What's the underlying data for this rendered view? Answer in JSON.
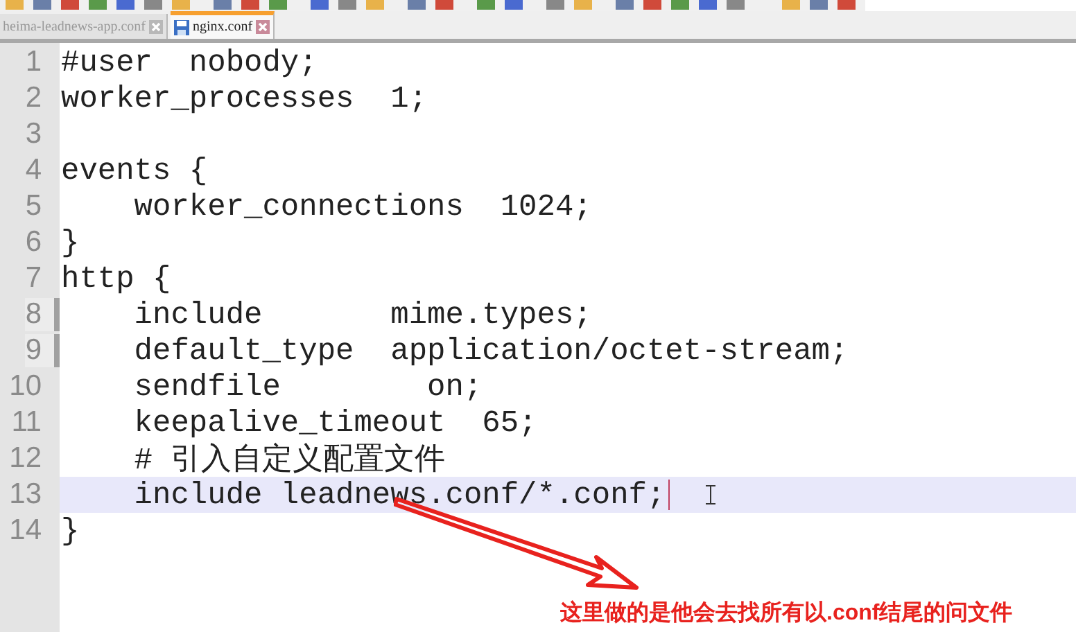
{
  "tabs": [
    {
      "label": "heima-leadnews-app.conf",
      "selected": false
    },
    {
      "label": "nginx.conf",
      "selected": true
    }
  ],
  "editor": {
    "lines": [
      {
        "number": "1",
        "text": "#user  nobody;",
        "current": false,
        "marked": false
      },
      {
        "number": "2",
        "text": "worker_processes  1;",
        "current": false,
        "marked": false
      },
      {
        "number": "3",
        "current": false,
        "marked": false
      },
      {
        "number": "4",
        "text": "events {",
        "current": false,
        "marked": false
      },
      {
        "number": "5",
        "text": "    worker_connections  1024;",
        "current": false,
        "marked": false
      },
      {
        "number": "6",
        "text": "}",
        "current": false,
        "marked": false
      },
      {
        "number": "7",
        "text": "http {",
        "current": false,
        "marked": false
      },
      {
        "number": "8",
        "text": "    include       mime.types;",
        "current": false,
        "marked": true
      },
      {
        "number": "9",
        "text": "    default_type  application/octet-stream;",
        "current": false,
        "marked": true
      },
      {
        "number": "10",
        "text": "    sendfile        on;",
        "current": false,
        "marked": false
      },
      {
        "number": "11",
        "text": "    keepalive_timeout  65;",
        "current": false,
        "marked": false
      },
      {
        "number": "12",
        "text": "    # 引入自定义配置文件",
        "current": false,
        "marked": false
      },
      {
        "number": "13",
        "text": "    include leadnews.conf/*.conf;",
        "current": true,
        "marked": false
      },
      {
        "number": "14",
        "text": "}",
        "current": false,
        "marked": false
      }
    ]
  },
  "annotation": {
    "text": "这里做的是他会去找所有以.conf结尾的问文件"
  }
}
